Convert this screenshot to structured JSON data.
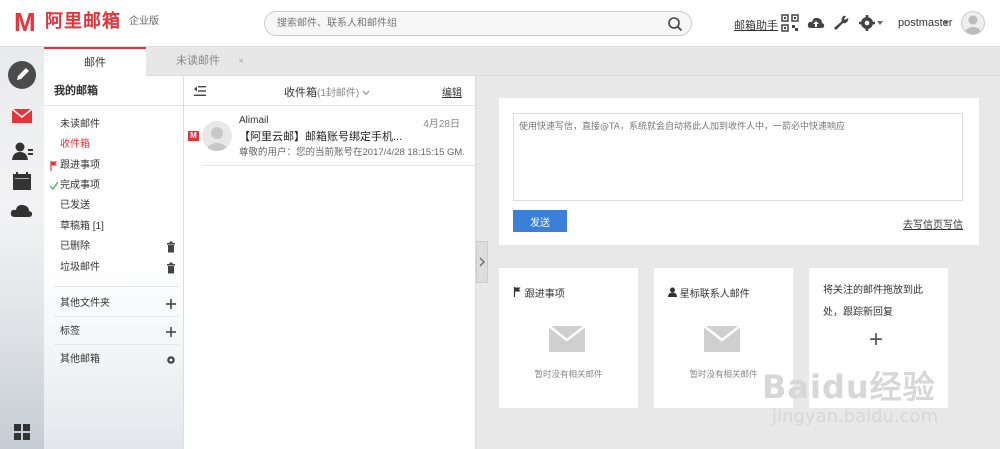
{
  "app": {
    "logo_letter": "M",
    "title": "阿里邮箱",
    "edition": "企业版"
  },
  "search": {
    "placeholder": "搜索邮件、联系人和邮件组"
  },
  "header": {
    "helper": "邮箱助手",
    "username": "postmaster"
  },
  "tabs": [
    {
      "label": "邮件"
    },
    {
      "label": "未读邮件",
      "close": "×"
    }
  ],
  "folders": {
    "title": "我的邮箱",
    "items": [
      {
        "label": "未读邮件"
      },
      {
        "label": "收件箱"
      },
      {
        "label": "跟进事项"
      },
      {
        "label": "完成事项"
      },
      {
        "label": "已发送"
      },
      {
        "label": "草稿箱 [1]"
      },
      {
        "label": "已删除"
      },
      {
        "label": "垃圾邮件"
      }
    ],
    "groups": [
      {
        "label": "其他文件夹"
      },
      {
        "label": "标签"
      },
      {
        "label": "其他邮箱"
      }
    ]
  },
  "list": {
    "title": "收件箱",
    "count": "(1封邮件)",
    "edit": "编辑",
    "mails": [
      {
        "from": "Alimail",
        "date": "4月28日",
        "subject": "【阿里云邮】邮箱账号绑定手机...",
        "preview": "尊敬的用户：您的当前账号在2017/4/28 18:15:15 GM...",
        "badge": "M"
      }
    ]
  },
  "compose": {
    "placeholder": "使用快速写信，直接@TA，系统就会自动将此人加到收件人中，一箭必中快速响应",
    "send": "发送",
    "go": "去写信页写信"
  },
  "cards": [
    {
      "title": "跟进事项",
      "empty": "暂时没有相关邮件"
    },
    {
      "title": "星标联系人邮件",
      "empty": "暂时没有相关邮件"
    },
    {
      "title": "将关注的邮件拖放到此处，跟踪新回复",
      "plus": "+"
    }
  ],
  "watermark": {
    "line1": "Baidu经验",
    "line2": "jingyan.baidu.com"
  },
  "colors": {
    "brand": "#e8333b",
    "button": "#3c7fd8"
  }
}
